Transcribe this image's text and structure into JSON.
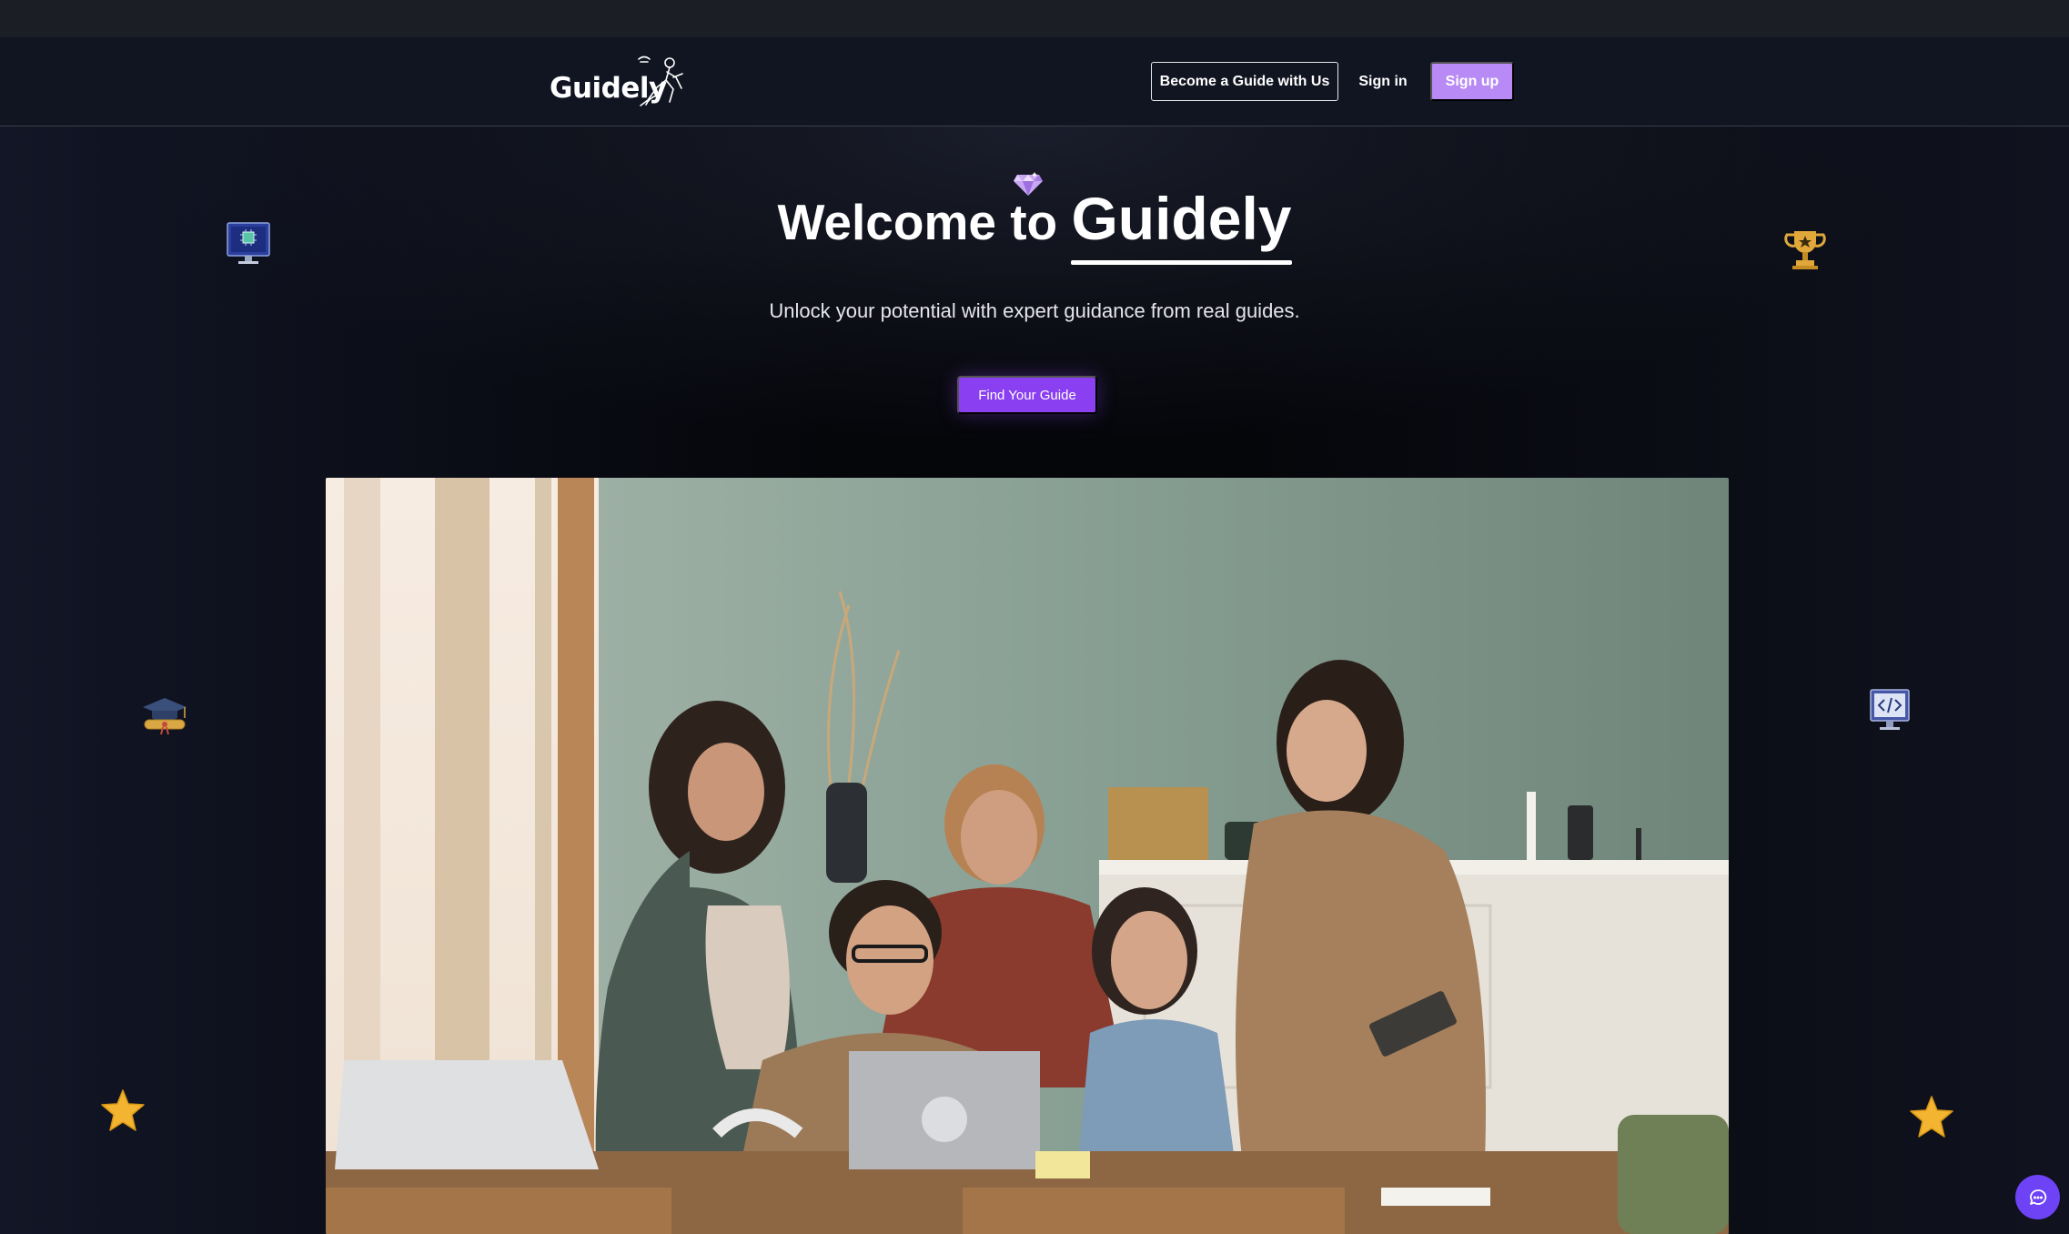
{
  "app": {
    "brand_name": "Guidely",
    "accent_color": "#8a3ff0",
    "signup_color": "#b78af5",
    "chat_color": "#6e42f5"
  },
  "navbar": {
    "logo_text": "Guidely",
    "become_guide_label": "Become a Guide with Us",
    "signin_label": "Sign in",
    "signup_label": "Sign up"
  },
  "hero": {
    "title_prefix": "Welcome to ",
    "title_brand": "Guidely",
    "subtitle": "Unlock your potential with expert guidance from real guides.",
    "cta_label": "Find Your Guide"
  },
  "decorations": {
    "icons": [
      "diamond-icon",
      "computer-chip-icon",
      "trophy-icon",
      "graduation-cap-icon",
      "code-monitor-icon",
      "star-icon",
      "star-icon"
    ]
  },
  "chat": {
    "icon": "chat-bubble-icon"
  }
}
